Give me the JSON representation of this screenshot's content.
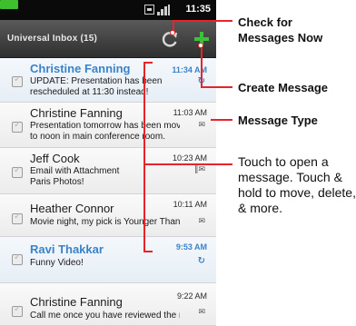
{
  "status_bar": {
    "time": "11:35"
  },
  "header": {
    "title": "Universal Inbox (15)"
  },
  "messages": [
    {
      "sender": "Christine Fanning",
      "subject_line1": "UPDATE:  Presentation has been",
      "subject_line2": "rescheduled at 11:30 instead!",
      "time": "11:34 AM",
      "unread": true,
      "type": "sync-icon"
    },
    {
      "sender": "Christine Fanning",
      "subject_line1": "Presentation tomorrow has been moved",
      "subject_line2": "to noon in main conference room.",
      "time": "11:03 AM",
      "unread": false,
      "type": "email-icon"
    },
    {
      "sender": "Jeff Cook",
      "subject_line1": "Email with Attachment",
      "subject_line2": "Paris Photos!",
      "time": "10:23 AM",
      "unread": false,
      "type": "attachment-email-icon"
    },
    {
      "sender": "Heather Connor",
      "subject_line1": "Movie night, my pick is Younger Than Ever",
      "subject_line2": "",
      "time": "10:11 AM",
      "unread": false,
      "type": "email-icon"
    },
    {
      "sender": "Ravi Thakkar",
      "subject_line1": "Funny Video!",
      "subject_line2": "",
      "time": "9:53 AM",
      "unread": true,
      "type": "sync-icon"
    },
    {
      "sender": "Christine Fanning",
      "subject_line1": "Call me once you have reviewed the n...",
      "subject_line2": "",
      "time": "9:22 AM",
      "unread": false,
      "type": "email-icon"
    }
  ],
  "callouts": {
    "check": "Check for Messages Now",
    "create": "Create Message",
    "type": "Message Type",
    "touch": "Touch to open a message. Touch & hold to move, delete, & more."
  },
  "colors": {
    "accent": "#3a83c8",
    "callout_line": "#e8232a",
    "compose_green": "#3cc23a"
  }
}
